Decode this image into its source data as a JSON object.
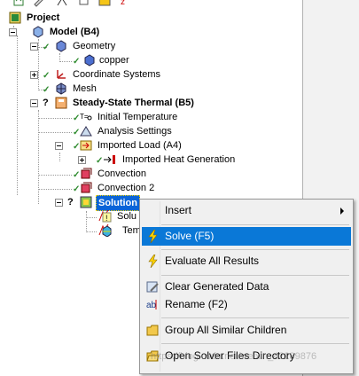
{
  "tree": {
    "project": "Project",
    "model": "Model (B4)",
    "geometry": "Geometry",
    "copper": "copper",
    "coordinate_systems": "Coordinate Systems",
    "mesh": "Mesh",
    "analysis": "Steady-State Thermal (B5)",
    "initial_temperature": "Initial Temperature",
    "analysis_settings": "Analysis Settings",
    "imported_load": "Imported Load (A4)",
    "imported_heat_generation": "Imported Heat Generation",
    "convection": "Convection",
    "convection2": "Convection 2",
    "solution": "Solution",
    "solution_info_partial": "Solu",
    "temperature_partial": "Tem"
  },
  "context_menu": {
    "insert": "Insert",
    "solve": "Solve (F5)",
    "evaluate": "Evaluate All Results",
    "clear": "Clear Generated Data",
    "rename": "Rename (F2)",
    "group": "Group All Similar Children",
    "open_dir": "Open Solver Files Directory"
  },
  "colors": {
    "highlight": "#0a78d7",
    "selection": "#0a64d8"
  },
  "watermark": "https://blog.csdn.net/weixin_42289876"
}
